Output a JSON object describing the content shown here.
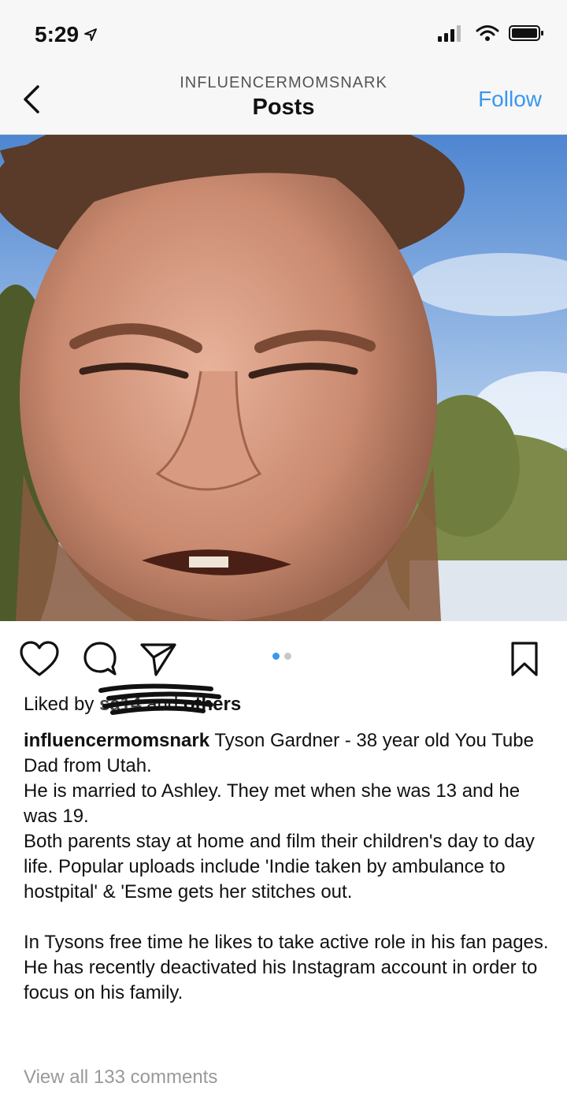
{
  "status_bar": {
    "time": "5:29",
    "icons": [
      "location-arrow-icon",
      "signal-icon",
      "wifi-icon",
      "battery-icon"
    ]
  },
  "header": {
    "username": "INFLUENCERMOMSNARK",
    "title": "Posts",
    "follow_label": "Follow",
    "accent_color": "#3897f0"
  },
  "post": {
    "image_icon": "photo-of-man-close-up",
    "carousel": {
      "count": 2,
      "active": 1
    },
    "liked_prefix": "Liked by",
    "liked_user": "sa14",
    "liked_and": "and",
    "liked_others": "others",
    "caption_user": "influencermomsnark",
    "caption_lines": [
      "Tyson Gardner - 38 year old You Tube Dad from Utah.",
      "He is married to Ashley. They met when she was 13 and he was 19.",
      "Both parents stay at home and film their children's day to day life. Popular uploads include 'Indie taken by ambulance to hostpital' & 'Esme gets her stitches out.",
      "In Tysons free time he likes to take active role in his fan pages.",
      "He has recently deactivated his Instagram account in order to focus on his family."
    ],
    "view_comments": "View all 133 comments"
  }
}
